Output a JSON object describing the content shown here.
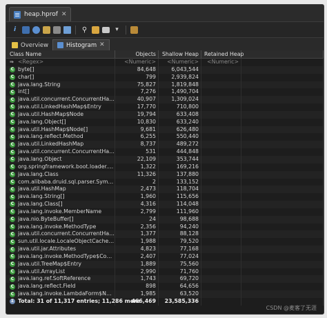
{
  "editor_tab": {
    "title": "heap.hprof",
    "close": "✕"
  },
  "view_tabs": [
    {
      "label": "Overview"
    },
    {
      "label": "Histogram",
      "close": "✕"
    }
  ],
  "columns": {
    "name": "Class Name",
    "objects": "Objects",
    "shallow": "Shallow Heap",
    "retained": "Retained Heap"
  },
  "filter_row": {
    "name": "<Regex>",
    "objects": "<Numeric>",
    "shallow": "<Numeric>",
    "retained": "<Numeric>"
  },
  "rows": [
    {
      "name": "byte[]",
      "objects": "84,648",
      "shallow": "6,043,544"
    },
    {
      "name": "char[]",
      "objects": "799",
      "shallow": "2,939,824"
    },
    {
      "name": "java.lang.String",
      "objects": "75,827",
      "shallow": "1,819,848"
    },
    {
      "name": "int[]",
      "objects": "7,276",
      "shallow": "1,490,704"
    },
    {
      "name": "java.util.concurrent.ConcurrentHashMa...",
      "objects": "40,907",
      "shallow": "1,309,024"
    },
    {
      "name": "java.util.LinkedHashMap$Entry",
      "objects": "17,770",
      "shallow": "710,800"
    },
    {
      "name": "java.util.HashMap$Node",
      "objects": "19,794",
      "shallow": "633,408"
    },
    {
      "name": "java.lang.Object[]",
      "objects": "10,830",
      "shallow": "633,240"
    },
    {
      "name": "java.util.HashMap$Node[]",
      "objects": "9,681",
      "shallow": "626,480"
    },
    {
      "name": "java.lang.reflect.Method",
      "objects": "6,255",
      "shallow": "550,440"
    },
    {
      "name": "java.util.LinkedHashMap",
      "objects": "8,737",
      "shallow": "489,272"
    },
    {
      "name": "java.util.concurrent.ConcurrentHashMa...",
      "objects": "531",
      "shallow": "444,848"
    },
    {
      "name": "java.lang.Object",
      "objects": "22,109",
      "shallow": "353,744"
    },
    {
      "name": "org.springframework.boot.loader.jar.Jar...",
      "objects": "1,322",
      "shallow": "169,216"
    },
    {
      "name": "java.lang.Class",
      "objects": "11,326",
      "shallow": "137,880"
    },
    {
      "name": "com.alibaba.druid.sql.parser.SymbolTab...",
      "objects": "2",
      "shallow": "133,152"
    },
    {
      "name": "java.util.HashMap",
      "objects": "2,473",
      "shallow": "118,704"
    },
    {
      "name": "java.lang.String[]",
      "objects": "1,960",
      "shallow": "115,656"
    },
    {
      "name": "java.lang.Class[]",
      "objects": "4,316",
      "shallow": "114,048"
    },
    {
      "name": "java.lang.invoke.MemberName",
      "objects": "2,799",
      "shallow": "111,960"
    },
    {
      "name": "java.nio.ByteBuffer[]",
      "objects": "24",
      "shallow": "98,688"
    },
    {
      "name": "java.lang.invoke.MethodType",
      "objects": "2,356",
      "shallow": "94,240"
    },
    {
      "name": "java.util.concurrent.ConcurrentHashMap",
      "objects": "1,377",
      "shallow": "88,128"
    },
    {
      "name": "sun.util.locale.LocaleObjectCache$Cac...",
      "objects": "1,988",
      "shallow": "79,520"
    },
    {
      "name": "java.util.jar.Attributes",
      "objects": "4,823",
      "shallow": "77,168"
    },
    {
      "name": "java.lang.invoke.MethodType$Concurre...",
      "objects": "2,407",
      "shallow": "77,024"
    },
    {
      "name": "java.util.TreeMap$Entry",
      "objects": "1,889",
      "shallow": "75,560"
    },
    {
      "name": "java.util.ArrayList",
      "objects": "2,990",
      "shallow": "71,760"
    },
    {
      "name": "java.lang.ref.SoftReference",
      "objects": "1,743",
      "shallow": "69,720"
    },
    {
      "name": "java.lang.reflect.Field",
      "objects": "898",
      "shallow": "64,656"
    },
    {
      "name": "java.lang.invoke.LambdaForm$Name",
      "objects": "1,985",
      "shallow": "63,520"
    }
  ],
  "total_row": {
    "name": "Total: 31 of 11,317 entries; 11,286 more",
    "objects": "466,469",
    "shallow": "23,585,336"
  },
  "watermark": "CSDN @麦客了无涯"
}
